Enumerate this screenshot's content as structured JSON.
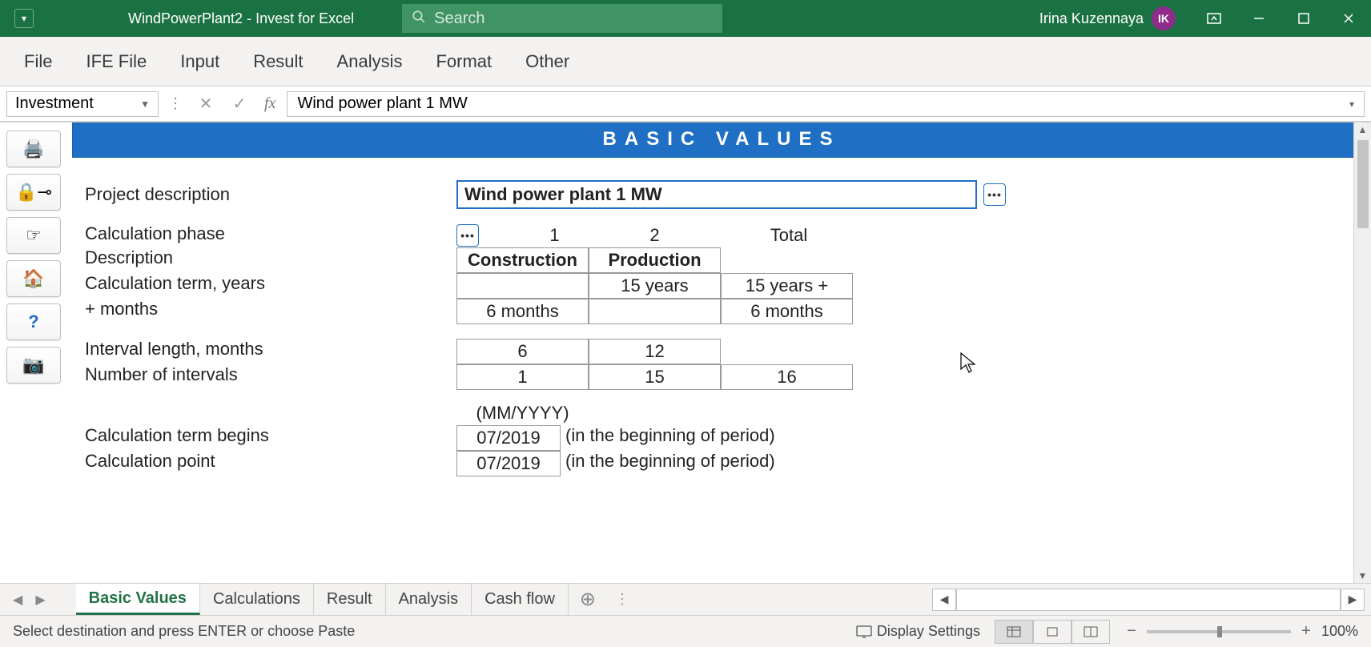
{
  "titlebar": {
    "title": "WindPowerPlant2  -  Invest for Excel",
    "search_placeholder": "Search",
    "user_name": "Irina Kuzennaya",
    "user_initials": "IK"
  },
  "ribbon": {
    "tabs": [
      "File",
      "IFE File",
      "Input",
      "Result",
      "Analysis",
      "Format",
      "Other"
    ]
  },
  "formula_bar": {
    "name_box": "Investment",
    "formula": "Wind power plant 1 MW"
  },
  "side_toolbar": {
    "items": [
      "print-icon",
      "lock-icon",
      "hand-icon",
      "home-icon",
      "help-icon",
      "camera-icon"
    ],
    "glyphs": [
      "🖨️",
      "🔒⊸",
      "☞",
      "🏠",
      "?",
      "📷"
    ]
  },
  "sheet": {
    "header": "BASIC VALUES",
    "rows": {
      "project_description_label": "Project description",
      "project_description_value": "Wind power plant 1 MW",
      "calc_phase_label": "Calculation phase",
      "description_label": "Description",
      "calc_term_years_label": "Calculation term, years",
      "plus_months_label": "+ months",
      "interval_length_label": "Interval length, months",
      "num_intervals_label": "Number of intervals",
      "mm_yyyy_label": "(MM/YYYY)",
      "calc_term_begins_label": "Calculation term begins",
      "calc_point_label": "Calculation point",
      "begin_note": "(in the beginning of period)",
      "point_note": "(in the beginning of period)"
    },
    "phase_headers": {
      "col1": "1",
      "col2": "2",
      "total": "Total"
    },
    "description_row": {
      "col1": "Construction",
      "col2": "Production"
    },
    "term_years_row": {
      "col1": "",
      "col2": "15 years",
      "total": "15 years +"
    },
    "months_row": {
      "col1": "6 months",
      "col2": "",
      "total": "6 months"
    },
    "interval_row": {
      "col1": "6",
      "col2": "12"
    },
    "numintervals_row": {
      "col1": "1",
      "col2": "15",
      "total": "16"
    },
    "begins_row": {
      "col1": "07/2019"
    },
    "point_row": {
      "col1": "07/2019"
    }
  },
  "tabs": {
    "items": [
      "Basic Values",
      "Calculations",
      "Result",
      "Analysis",
      "Cash flow"
    ],
    "active_index": 0
  },
  "statusbar": {
    "message": "Select destination and press ENTER or choose Paste",
    "display_settings": "Display Settings",
    "zoom": "100%"
  }
}
